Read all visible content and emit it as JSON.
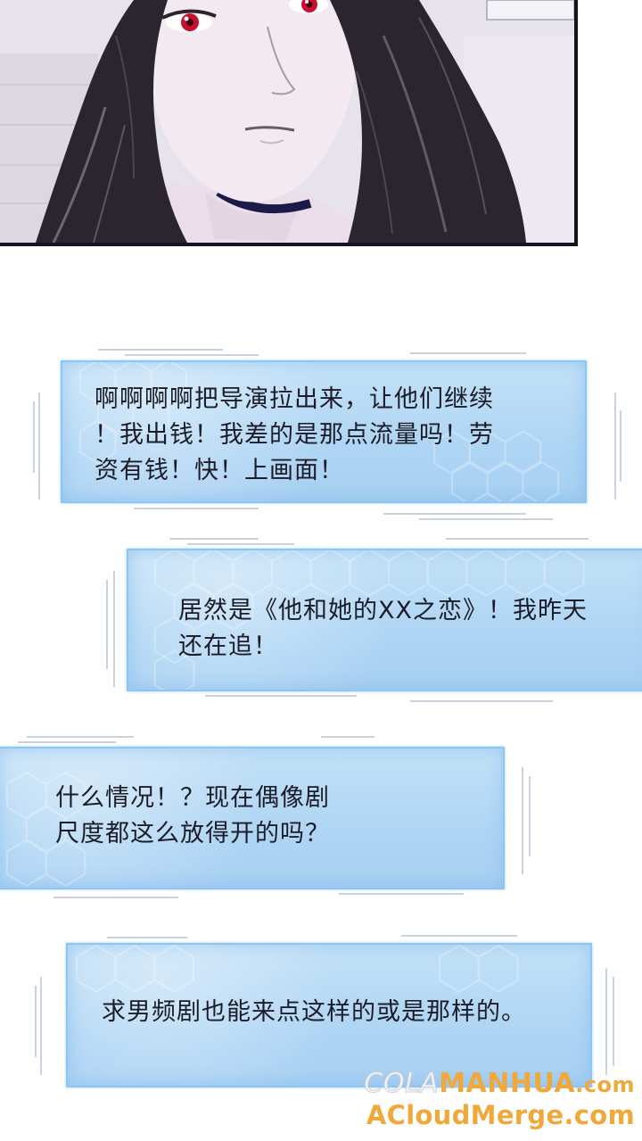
{
  "comments": [
    {
      "text": "啊啊啊啊把导演拉出来，让他们继续\n！我出钱！我差的是那点流量吗！劳\n资有钱！快！上画面！"
    },
    {
      "text": "居然是《他和她的XX之恋》！我昨天\n还在追！"
    },
    {
      "text": "什么情况！？现在偶像剧\n尺度都这么放得开的吗？"
    },
    {
      "text": "求男频剧也能来点这样的或是那样的。"
    }
  ],
  "watermark": {
    "line1_a": "COLA",
    "line1_b": "MANHUA",
    "line1_c": ".com",
    "line2": "ACloudMerge.com"
  },
  "colors": {
    "bubble_border": "#8fc6f1",
    "bubble_fill": "#b0d6f4",
    "panel_border": "#141420",
    "watermark_orange": "#f1a83a",
    "eye_red": "#c8102e"
  }
}
